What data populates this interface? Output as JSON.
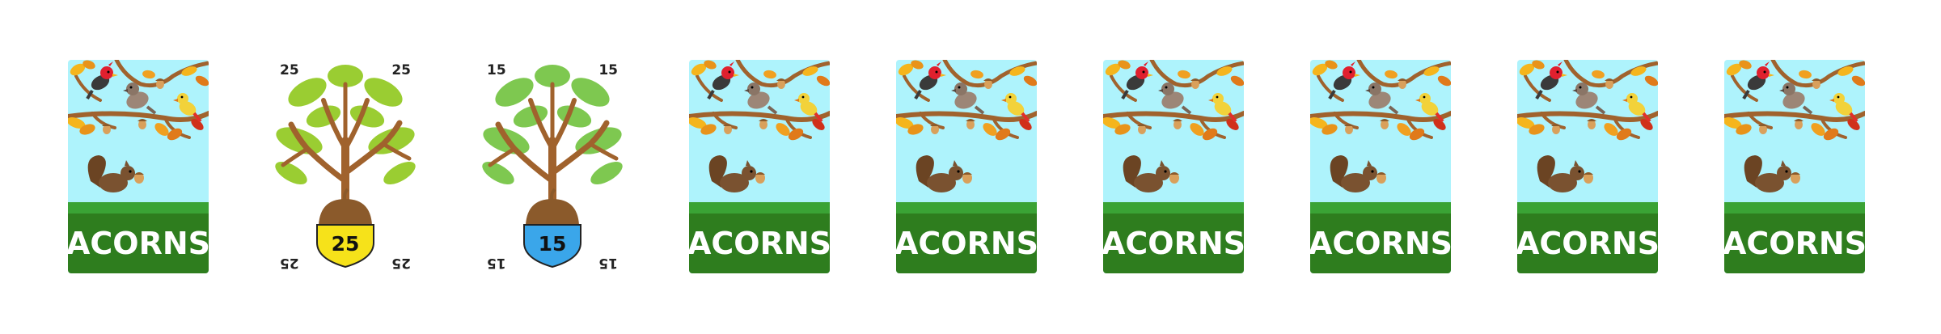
{
  "cards": [
    {
      "type": "back",
      "title": "ACORNS"
    },
    {
      "type": "value",
      "value": "25",
      "color": "#f6e21a",
      "leaf_shade": "#9acd32"
    },
    {
      "type": "value",
      "value": "15",
      "color": "#3aa6ea",
      "leaf_shade": "#7ec850"
    },
    {
      "type": "back",
      "title": "ACORNS"
    },
    {
      "type": "back",
      "title": "ACORNS"
    },
    {
      "type": "back",
      "title": "ACORNS"
    },
    {
      "type": "back",
      "title": "ACORNS"
    },
    {
      "type": "back",
      "title": "ACORNS"
    },
    {
      "type": "back",
      "title": "ACORNS"
    }
  ],
  "colors": {
    "sky": "#aef3fc",
    "grass_light": "#3aa335",
    "grass_dark": "#2e7d1e",
    "branch": "#a0622d",
    "acorn_cap": "#8b5a2b",
    "acorn_body": "#d9a05b",
    "squirrel": "#7a5230"
  },
  "icons": [
    "cardinal-icon",
    "sparrow-icon",
    "yellow-bird-icon",
    "squirrel-icon",
    "acorn-icon",
    "oak-tree-icon"
  ]
}
